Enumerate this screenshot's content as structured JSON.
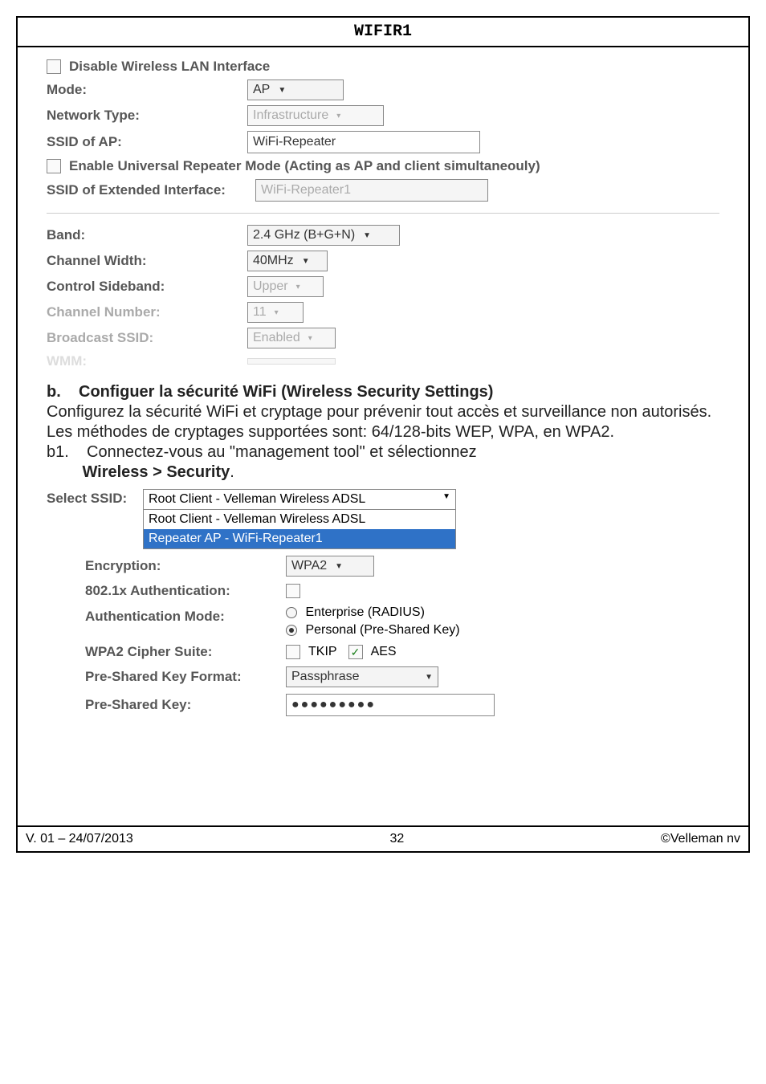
{
  "header": {
    "title": "WIFIR1"
  },
  "top_form": {
    "disable_label": "Disable Wireless LAN Interface",
    "mode_label": "Mode:",
    "mode_value": "AP",
    "network_type_label": "Network Type:",
    "network_type_value": "Infrastructure",
    "ssid_ap_label": "SSID of AP:",
    "ssid_ap_value": "WiFi-Repeater",
    "enable_universal_label": "Enable Universal Repeater Mode (Acting as AP and client simultaneouly)",
    "ssid_ext_label": "SSID of Extended Interface:",
    "ssid_ext_value": "WiFi-Repeater1",
    "band_label": "Band:",
    "band_value": "2.4 GHz (B+G+N)",
    "ch_width_label": "Channel Width:",
    "ch_width_value": "40MHz",
    "ctl_sideband_label": "Control Sideband:",
    "ctl_sideband_value": "Upper",
    "ch_num_label": "Channel Number:",
    "ch_num_value": "11",
    "broadcast_label": "Broadcast SSID:",
    "broadcast_value": "Enabled",
    "wmm_label": "WMM:"
  },
  "section_b": {
    "heading_prefix": "b.",
    "heading": "Configuer la sécurité WiFi (Wireless Security Settings)",
    "para": "Configurez la sécurité WiFi et cryptage pour prévenir tout accès et surveillance non autorisés. Les méthodes de cryptages supportées sont: 64/128-bits WEP, WPA, en WPA2.",
    "b1_prefix": "b1.",
    "b1_text_a": "Connectez-vous au \"management tool\" et sélectionnez ",
    "b1_text_b": "Wireless > Security",
    "b1_text_c": "."
  },
  "security": {
    "select_ssid_label": "Select SSID:",
    "dd_head": "Root Client - Velleman Wireless ADSL",
    "dd_items": [
      "Root Client - Velleman Wireless ADSL",
      "Repeater AP - WiFi-Repeater1"
    ],
    "encryption_label": "Encryption:",
    "encryption_value": "WPA2",
    "auth8021x_label": "802.1x Authentication:",
    "auth_mode_label": "Authentication Mode:",
    "auth_mode_opt1": "Enterprise (RADIUS)",
    "auth_mode_opt2": "Personal (Pre-Shared Key)",
    "cipher_label": "WPA2 Cipher Suite:",
    "cipher_tkip": "TKIP",
    "cipher_aes": "AES",
    "psk_format_label": "Pre-Shared Key Format:",
    "psk_format_value": "Passphrase",
    "psk_label": "Pre-Shared Key:",
    "psk_value": "●●●●●●●●●"
  },
  "footer": {
    "left": "V. 01 – 24/07/2013",
    "center": "32",
    "right": "©Velleman nv"
  }
}
